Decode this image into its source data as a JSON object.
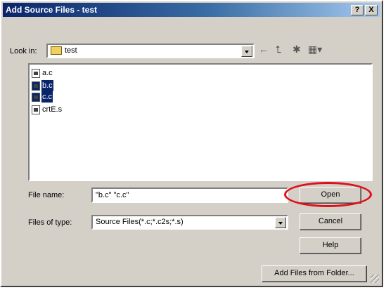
{
  "window": {
    "title": "Add Source Files - test",
    "help_btn": "?",
    "close_btn": "X"
  },
  "look_in": {
    "label": "Look in:",
    "value": "test"
  },
  "toolbar": {
    "back": "←",
    "up": "⮤",
    "new_folder": "✱",
    "view": "▦▾"
  },
  "files": [
    {
      "name": "a.c",
      "selected": false
    },
    {
      "name": "b.c",
      "selected": true
    },
    {
      "name": "c.c",
      "selected": true
    },
    {
      "name": "crtE.s",
      "selected": false
    }
  ],
  "file_name": {
    "label": "File name:",
    "value": "\"b.c\" \"c.c\""
  },
  "file_type": {
    "label": "Files of type:",
    "value": "Source Files(*.c;*.c2s;*.s)"
  },
  "buttons": {
    "open": "Open",
    "cancel": "Cancel",
    "help": "Help",
    "add_folder": "Add Files from Folder..."
  },
  "colors": {
    "highlight": "#0a246a",
    "annotation": "#e0101a"
  }
}
